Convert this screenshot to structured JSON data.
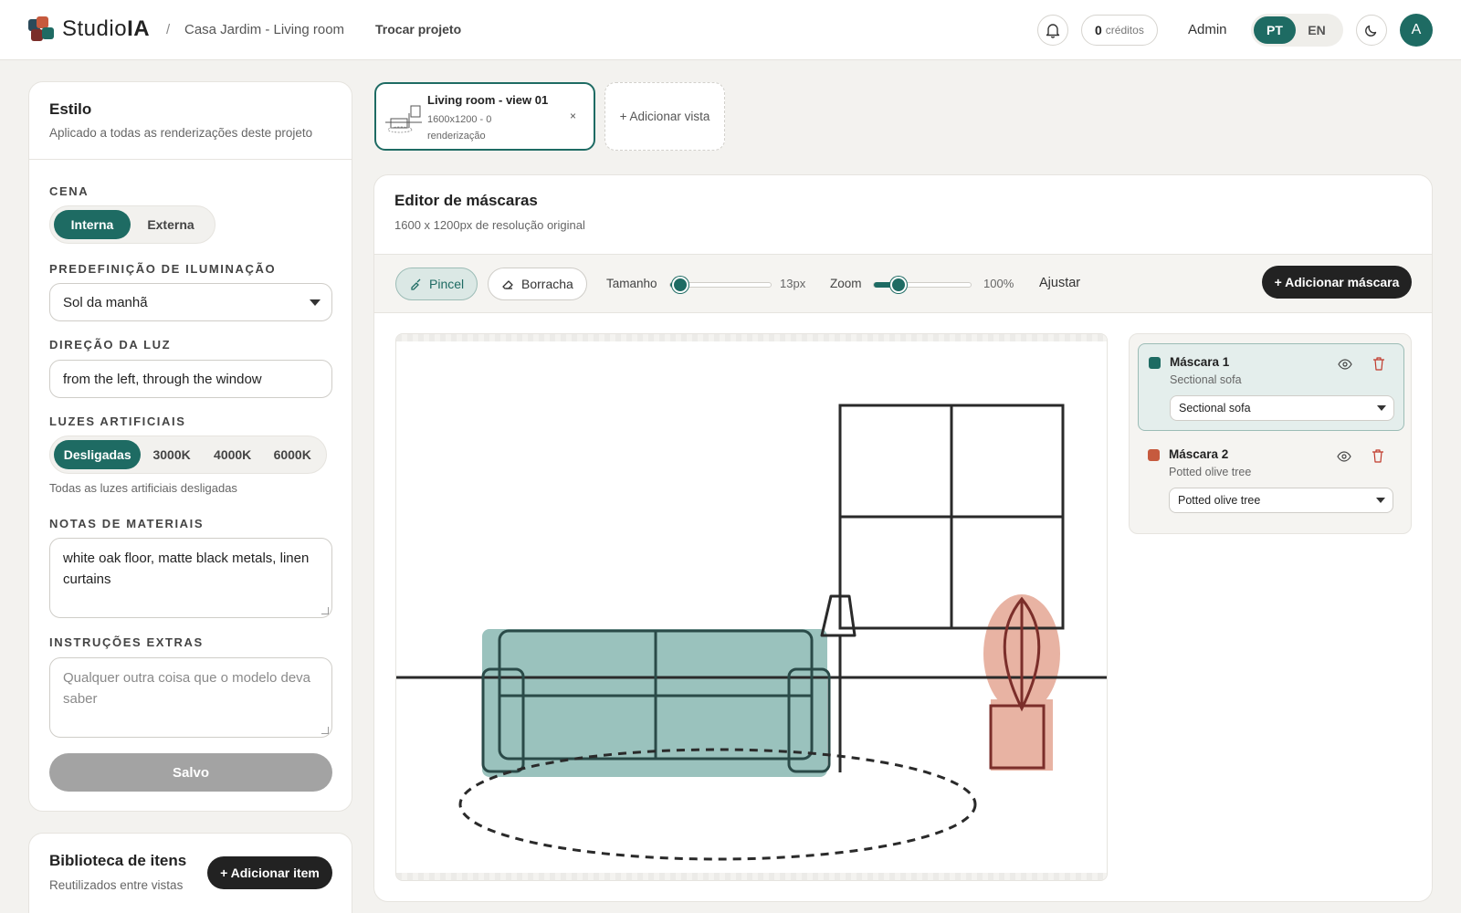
{
  "header": {
    "brand_light": "Studio",
    "brand_bold": "IA",
    "separator": "/",
    "project": "Casa Jardim - Living room",
    "switch_project": "Trocar projeto",
    "credits_count": "0",
    "credits_label": "créditos",
    "admin": "Admin",
    "lang_pt": "PT",
    "lang_en": "EN",
    "avatar_initial": "A"
  },
  "style": {
    "title": "Estilo",
    "subtitle": "Aplicado a todas as renderizações deste projeto",
    "scene_label": "CENA",
    "scene_internal": "Interna",
    "scene_external": "Externa",
    "lighting_label": "PREDEFINIÇÃO DE ILUMINAÇÃO",
    "lighting_value": "Sol da manhã",
    "light_dir_label": "DIREÇÃO DA LUZ",
    "light_dir_value": "from the left, through the window",
    "artificial_label": "LUZES ARTIFICIAIS",
    "artificial_options": [
      "Desligadas",
      "3000K",
      "4000K",
      "6000K"
    ],
    "artificial_help": "Todas as luzes artificiais desligadas",
    "materials_label": "NOTAS DE MATERIAIS",
    "materials_value": "white oak floor, matte black metals, linen curtains",
    "extras_label": "INSTRUÇÕES EXTRAS",
    "extras_placeholder": "Qualquer outra coisa que o modelo deva saber",
    "save_label": "Salvo"
  },
  "library": {
    "title": "Biblioteca de itens",
    "subtitle": "Reutilizados entre vistas",
    "add_label": "+ Adicionar item"
  },
  "views": {
    "active_name": "Living room - view 01",
    "active_meta": "1600x1200 - 0 renderização",
    "close": "×",
    "add_label": "+ Adicionar vista"
  },
  "editor": {
    "title": "Editor de máscaras",
    "subtitle": "1600 x 1200px de resolução original",
    "brush": "Pincel",
    "eraser": "Borracha",
    "size_label": "Tamanho",
    "size_value": "13px",
    "size_level": 0.1,
    "zoom_label": "Zoom",
    "zoom_value": "100%",
    "zoom_level": 0.25,
    "fit": "Ajustar",
    "add_mask": "+ Adicionar máscara"
  },
  "masks": [
    {
      "name": "Máscara 1",
      "subject": "Sectional sofa",
      "selected": "Sectional sofa",
      "color": "#1e6b63"
    },
    {
      "name": "Máscara 2",
      "subject": "Potted olive tree",
      "selected": "Potted olive tree",
      "color": "#c65a3e"
    }
  ],
  "colors": {
    "accent": "#1e6b63",
    "mask1_fill": "#9ac2bd",
    "mask2_fill": "#e8b3a3"
  }
}
